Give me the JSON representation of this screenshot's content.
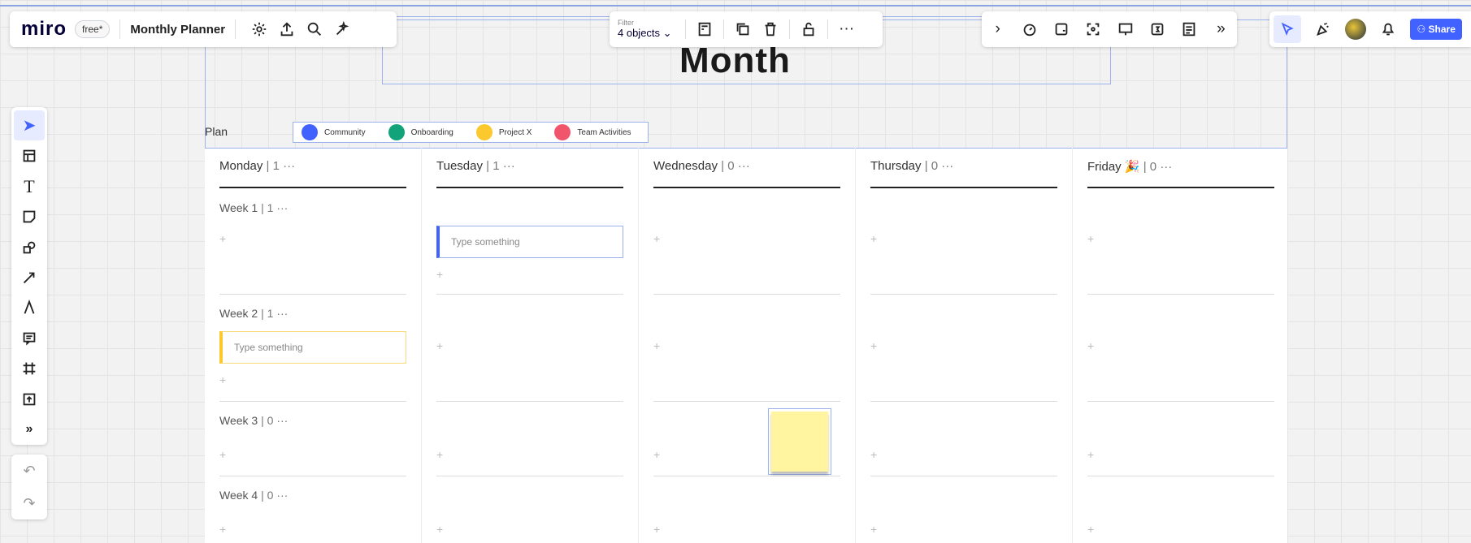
{
  "app": {
    "logo": "miro",
    "plan": "free",
    "plan_mark": "*",
    "board_name": "Monthly Planner"
  },
  "context_toolbar": {
    "filter_label": "Filter",
    "filter_value": "4 objects"
  },
  "right_toolbar": {
    "share_label": "Share"
  },
  "canvas": {
    "title": "Month",
    "plan_label": "Plan",
    "legend": [
      {
        "label": "Community",
        "color": "#4262ff"
      },
      {
        "label": "Onboarding",
        "color": "#12a37a"
      },
      {
        "label": "Project X",
        "color": "#fbc82d"
      },
      {
        "label": "Team Activities",
        "color": "#f1556b"
      }
    ]
  },
  "days": [
    {
      "name": "Monday",
      "count": "1"
    },
    {
      "name": "Tuesday",
      "count": "1"
    },
    {
      "name": "Wednesday",
      "count": "0"
    },
    {
      "name": "Thursday",
      "count": "0"
    },
    {
      "name": "Friday",
      "count": "0"
    }
  ],
  "weeks": [
    {
      "name": "Week 1",
      "count": "1"
    },
    {
      "name": "Week 2",
      "count": "1"
    },
    {
      "name": "Week 3",
      "count": "0"
    },
    {
      "name": "Week 4",
      "count": "0"
    }
  ],
  "cards": {
    "tuesday_week1": "Type something",
    "monday_week2": "Type something"
  },
  "icons": {
    "more": "···",
    "plus": "+",
    "separator": "|"
  }
}
